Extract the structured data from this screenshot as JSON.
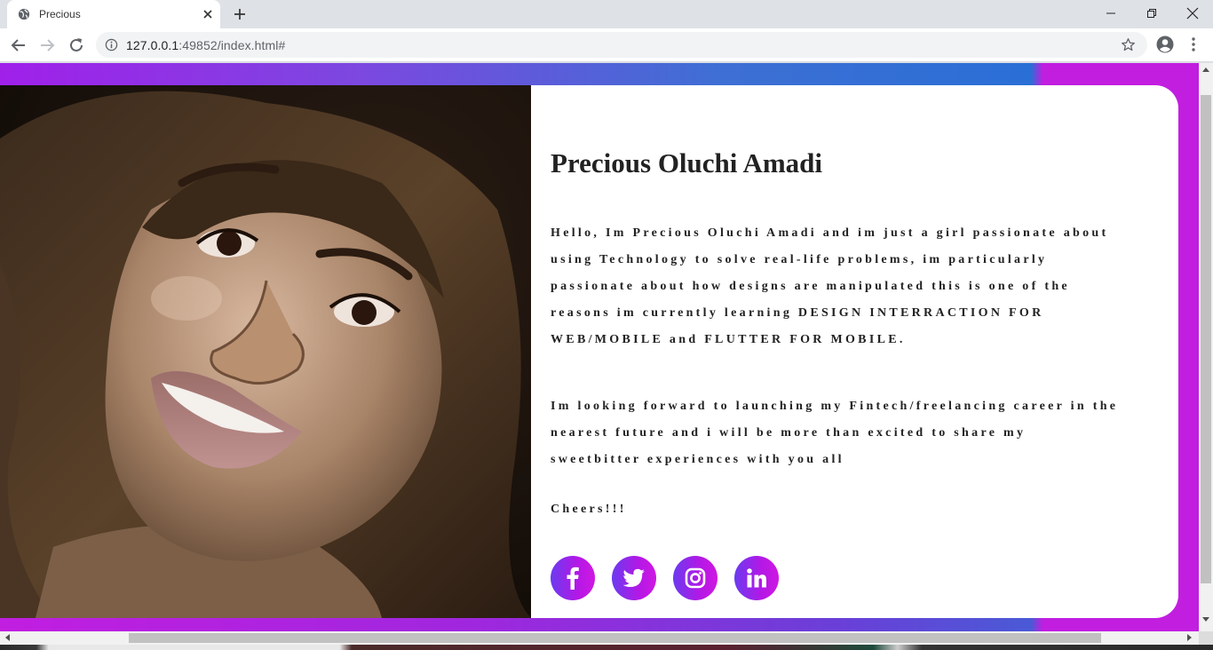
{
  "browser": {
    "tab_title": "Precious",
    "url_host": "127.0.0.1",
    "url_rest": ":49852/index.html#"
  },
  "profile": {
    "name": "Precious Oluchi Amadi",
    "paragraph1": "Hello, Im Precious Oluchi Amadi and im just a girl passionate about using Technology to solve real-life problems, im particularly passionate about how designs are manipulated this is one of the reasons im currently learning DESIGN INTERRACTION FOR WEB/MOBILE and FLUTTER FOR MOBILE.",
    "paragraph2": "Im looking forward to launching my Fintech/freelancing career in the nearest future and i will be more than excited to share my sweetbitter experiences with you all",
    "closing": "Cheers!!!"
  },
  "socials": [
    {
      "icon": "facebook-icon"
    },
    {
      "icon": "twitter-icon"
    },
    {
      "icon": "instagram-icon"
    },
    {
      "icon": "linkedin-icon"
    }
  ],
  "colors": {
    "accent_start": "#6b3bef",
    "accent_end": "#d018e2",
    "background_purple": "#c11ee0",
    "background_blue": "#2a6fd6"
  }
}
